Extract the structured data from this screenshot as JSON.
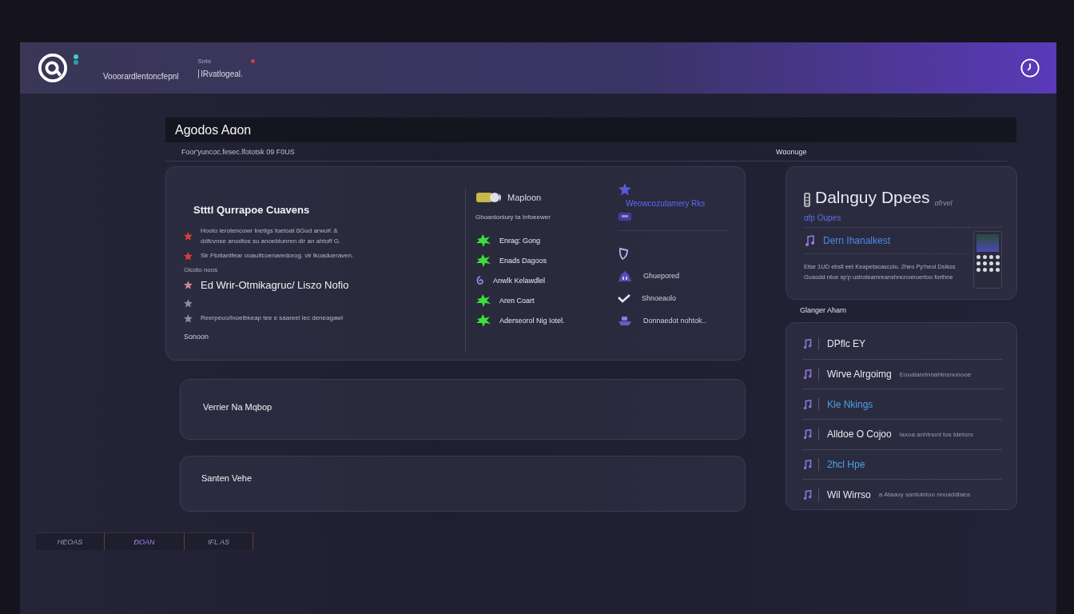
{
  "header": {
    "small_label": "Sɑtɑ",
    "title": "Vooorardlentoncfepnl",
    "subtitle": "lRvatlogeal."
  },
  "panel": {
    "title": "Agodos Aɑon",
    "subtitle": "Foor'yuncoc.fesec.lfototsk 09 F0US",
    "side_label": "Wɑonuge"
  },
  "overview": {
    "heading": "Stttl Qurrapoe Cuavens",
    "items": [
      {
        "kind": "small",
        "color": "#e23a34",
        "text": "Hooto lerotencowr Inetlgs foetoat 6Gud arwuK & ddfcvnse anodtos su anoeblunren dir an ahtoff G."
      },
      {
        "kind": "small",
        "color": "#e23a34",
        "text": "Sir Ftotlantfear ooauifcoenaredorog. vir lkoadueraven."
      },
      {
        "kind": "label",
        "text": "Glcdio noos"
      },
      {
        "kind": "large",
        "color": "#c98a9a",
        "text": "Ed Wrir-Otmikagruc/ Liszo Nofio"
      },
      {
        "kind": "small",
        "color": "#8a8aa4"
      },
      {
        "kind": "small",
        "color": "#8a8aa4",
        "text": "Reerpeuo/lnoelbkeap tee e saareel lec deneagawl"
      }
    ],
    "footer": "Sonoon"
  },
  "map": {
    "title": "Maploon",
    "subtitle": "Ghoanlonlury ta Infoeewer",
    "link": "Weowcozutamery Rks",
    "items": [
      {
        "kind": "splat",
        "label": "Enrag: Gong"
      },
      {
        "kind": "splat",
        "label": "Enads Dagoos"
      },
      {
        "kind": "swirl",
        "label": "Anwlk Kelawdlel"
      },
      {
        "kind": "splat",
        "label": "Aren Coart"
      },
      {
        "kind": "splat",
        "label": "Aderseorol Nig Iotel."
      }
    ],
    "side_items": [
      {
        "kind": "shield"
      },
      {
        "kind": "building",
        "label": "Ghuepored"
      },
      {
        "kind": "check",
        "label": "Shnoeaolo"
      },
      {
        "kind": "ship",
        "label": "Donnaedot nohtok.."
      }
    ]
  },
  "cards": [
    {
      "title": "Verrier Na Mqbop"
    },
    {
      "title": "Santen Vehe"
    }
  ],
  "tabs": [
    {
      "label": "HEOAS",
      "selected": false
    },
    {
      "label": "ĐOAN",
      "selected": true
    },
    {
      "label": "IFL AS",
      "selected": false
    }
  ],
  "feature": {
    "title": "Dalnguy Dpees",
    "note": "ɑfrvel",
    "subtitle": "ɑfp Oupes",
    "row_title": "Dern Ihanalkest",
    "text": "Etse 1UD ebsll eet Keapetacascolu. 2heo Pp'heol Dsikss Goaodd ntoe sp'p usboteamreanshncnoeroertoo forthne"
  },
  "activity": {
    "label": "Glanger Aharn",
    "rows": [
      {
        "title": "DPflc  EY",
        "color": "#e8e8f0"
      },
      {
        "title": "Wirve Alrgoimg",
        "color": "#e8e8f0",
        "detail": "Eooalanrtnnahtnsnunooe"
      },
      {
        "title": "Kle Nkings",
        "color": "#4aa0e8"
      },
      {
        "title": "Alldoe O Cojoo",
        "color": "#e8e8f0",
        "detail": "laxoa anhtnonl tos tdetoro"
      },
      {
        "title": "2hcl Hpe",
        "color": "#4aa0e8"
      },
      {
        "title": "Wil Wirrso",
        "color": "#e8e8f0",
        "detail": "a Ataauy santulntoo nnoaddlaea"
      }
    ]
  }
}
